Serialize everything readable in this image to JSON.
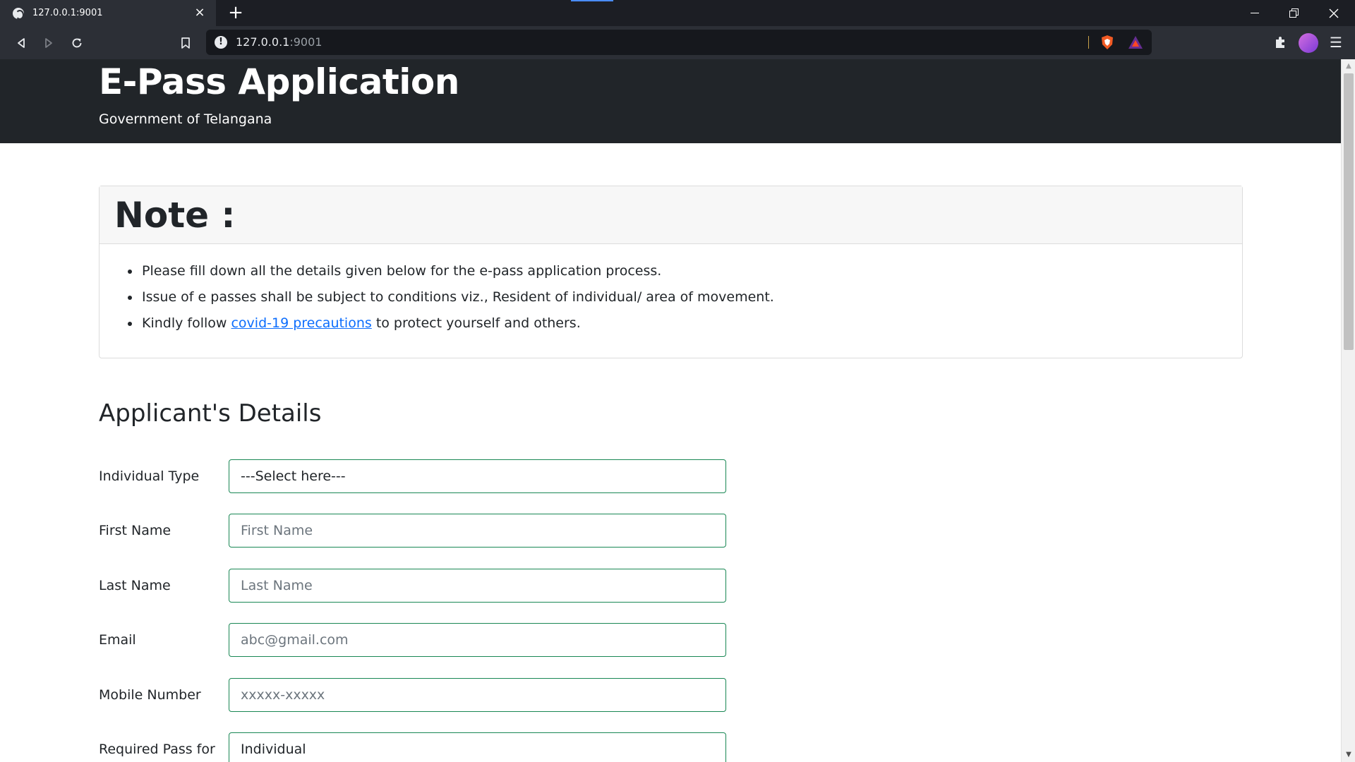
{
  "browser": {
    "tab_title": "127.0.0.1:9001",
    "url_host": "127.0.0.1",
    "url_port": ":9001"
  },
  "header": {
    "title": "E-Pass Application",
    "subtitle": "Government of Telangana"
  },
  "note": {
    "title": "Note :",
    "items": [
      "Please fill down all the details given below for the e-pass application process.",
      "Issue of e passes shall be subject to conditions viz., Resident of individual/ area of movement."
    ],
    "item3_prefix": "Kindly follow ",
    "item3_link": "covid-19 precautions",
    "item3_suffix": " to protect yourself and others."
  },
  "applicant": {
    "section_title": "Applicant's Details",
    "fields": [
      {
        "label": "Individual Type",
        "value": "---Select here---"
      },
      {
        "label": "First Name",
        "placeholder": "First Name"
      },
      {
        "label": "Last Name",
        "placeholder": "Last Name"
      },
      {
        "label": "Email",
        "placeholder": "abc@gmail.com"
      },
      {
        "label": "Mobile Number",
        "placeholder": "xxxxx-xxxxx"
      },
      {
        "label": "Required Pass for",
        "value": "Individual"
      }
    ]
  },
  "colors": {
    "header_bg": "#212529",
    "field_border": "#198754",
    "link": "#0d6efd"
  }
}
